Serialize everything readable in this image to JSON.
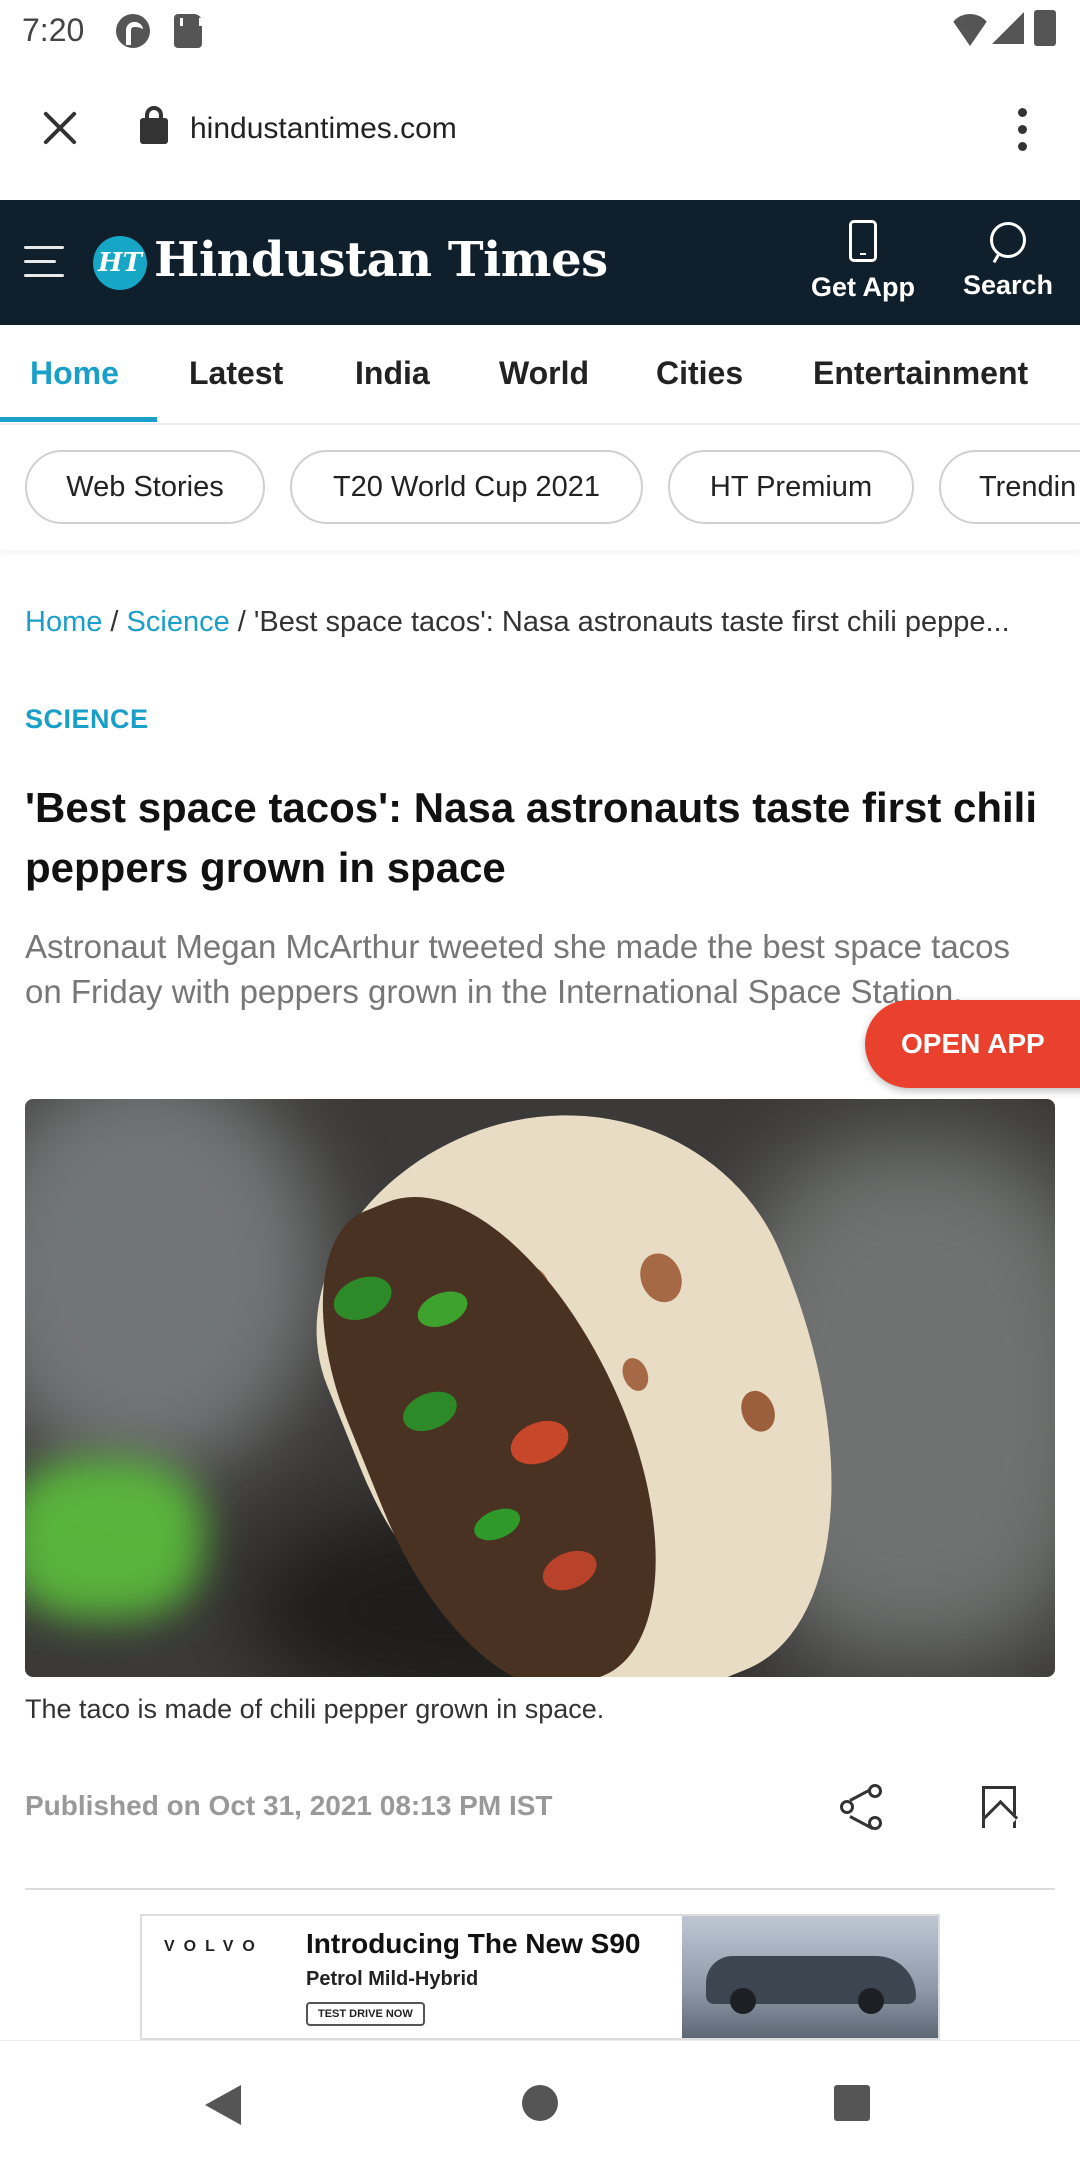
{
  "status_bar": {
    "time": "7:20"
  },
  "browser": {
    "url": "hindustantimes.com"
  },
  "header": {
    "logo_badge": "HT",
    "logo_text": "Hindustan Times",
    "get_app_label": "Get App",
    "search_label": "Search",
    "bg_color": "#0f1f2b",
    "accent_color": "#1a9fc8"
  },
  "nav_tabs": [
    "Home",
    "Latest",
    "India",
    "World",
    "Cities",
    "Entertainment"
  ],
  "active_tab": "Home",
  "pills": [
    "Web Stories",
    "T20 World Cup 2021",
    "HT Premium",
    "Trendin"
  ],
  "breadcrumb": {
    "home": "Home",
    "sep1": " / ",
    "section": "Science",
    "sep2": " / ",
    "current": "'Best space tacos': Nasa astronauts taste first chili peppe..."
  },
  "article": {
    "section": "SCIENCE",
    "headline": "'Best space tacos': Nasa astronauts taste first chili peppers grown in space",
    "summary": "Astronaut Megan McArthur tweeted she made the best space tacos on Friday with peppers grown in the International Space Station.",
    "caption": "The taco is made of chili pepper grown in space.",
    "published": "Published on Oct 31, 2021 08:13 PM IST"
  },
  "open_app": {
    "label": "OPEN APP",
    "color": "#e9412d"
  },
  "ad": {
    "brand": "VOLVO",
    "title": "Introducing The New S90",
    "subtitle": "Petrol Mild-Hybrid",
    "cta": "TEST DRIVE NOW"
  }
}
